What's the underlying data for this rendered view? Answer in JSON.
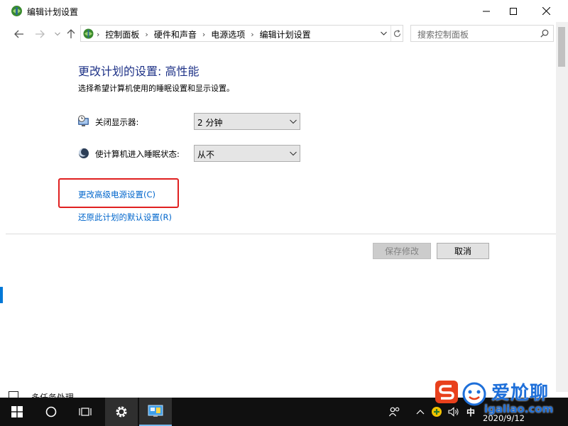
{
  "window": {
    "title": "编辑计划设置"
  },
  "address_bar": {
    "breadcrumbs": [
      "控制面板",
      "硬件和声音",
      "电源选项",
      "编辑计划设置"
    ],
    "search_placeholder": "搜索控制面板"
  },
  "content": {
    "heading": "更改计划的设置: 高性能",
    "subtitle": "选择希望计算机使用的睡眠设置和显示设置。",
    "settings": [
      {
        "label": "关闭显示器:",
        "value": "2 分钟",
        "icon": "monitor-clock-icon"
      },
      {
        "label": "使计算机进入睡眠状态:",
        "value": "从不",
        "icon": "moon-icon"
      }
    ],
    "links": {
      "advanced": "更改高级电源设置(C)",
      "restore": "还原此计划的默认设置(R)"
    },
    "buttons": {
      "save": "保存修改",
      "cancel": "取消"
    }
  },
  "background_text": "多任务处理",
  "taskbar": {
    "ime": "中",
    "date": "2020/9/12"
  },
  "watermark": {
    "brand": "爱尬聊",
    "url": "igaliao.com"
  },
  "colors": {
    "heading": "#1e3287",
    "link": "#0066cc",
    "highlight_box": "#e02020",
    "taskbar": "#101010",
    "accent": "#0078d7"
  }
}
